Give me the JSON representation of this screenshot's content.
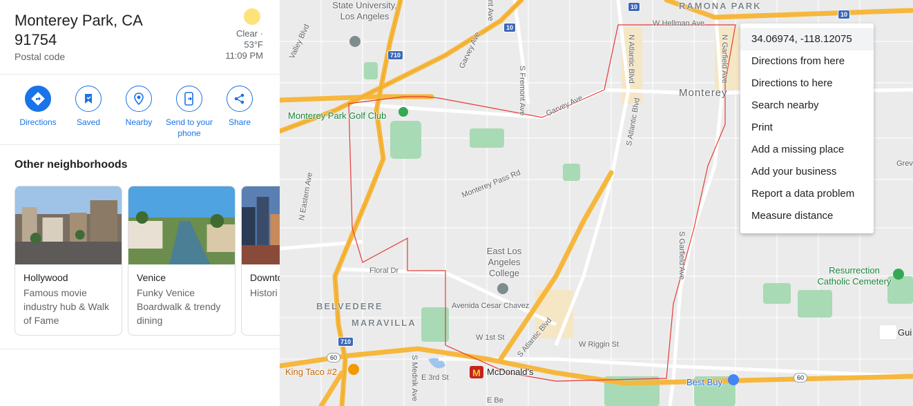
{
  "place": {
    "title": "Monterey Park, CA 91754",
    "subtitle": "Postal code",
    "weather": {
      "condition": "Clear ·",
      "temperature": "53°F",
      "time": "11:09 PM"
    }
  },
  "actions": [
    {
      "label": "Directions",
      "icon": "directions-icon"
    },
    {
      "label": "Saved",
      "icon": "bookmark-icon"
    },
    {
      "label": "Nearby",
      "icon": "nearby-icon"
    },
    {
      "label": "Send to your phone",
      "icon": "send-to-phone-icon"
    },
    {
      "label": "Share",
      "icon": "share-icon"
    }
  ],
  "neighborhoods": {
    "heading": "Other neighborhoods",
    "cards": [
      {
        "title": "Hollywood",
        "description": "Famous movie industry hub & Walk of Fame"
      },
      {
        "title": "Venice",
        "description": "Funky Venice Boardwalk & trendy dining"
      },
      {
        "title": "Downto",
        "description": "Histori cool ea"
      }
    ]
  },
  "map": {
    "labels": {
      "state_university": "State University, Los Angeles",
      "ramona_park": "RAMONA PARK",
      "monterey": "Monterey",
      "golf_club": "Monterey Park Golf Club",
      "belvedere": "BELVEDERE",
      "maravilla": "MARAVILLA",
      "elac": "East Los Angeles College",
      "resurrection": "Resurrection Catholic Cemetery",
      "king_taco": "King Taco #2",
      "mcdonalds": "McDonald's",
      "best_buy": "Best Buy",
      "gui": "Gui"
    },
    "streets": {
      "w_hellman": "W Hellman Ave",
      "garvey": "Garvey Ave",
      "garvey2": "Garvey Ave",
      "s_fremont": "S Fremont Ave",
      "monterey_pass": "Monterey Pass Rd",
      "s_atlantic": "S Atlantic Blvd",
      "s_atlantic2": "S Atlantic Blvd",
      "n_atlantic": "N Atlantic Blvd",
      "n_garfield": "N Garfield Ave",
      "s_garfield": "S Garfield Ave",
      "n_eastern": "N Eastern Ave",
      "floral": "Floral Dr",
      "cesar_chavez": "Avenida Cesar Chavez",
      "w_1st": "W 1st St",
      "w_riggin": "W Riggin St",
      "e_3rd": "E 3rd St",
      "s_mednik": "S Mednik Ave",
      "valley": "Valley Blvd",
      "nt_ave": "nt Ave",
      "grev": "Grev",
      "e_be": "E Be"
    },
    "shields": {
      "i10a": "10",
      "i10b": "10",
      "i10c": "10",
      "i710a": "710",
      "i710b": "710",
      "r60a": "60",
      "r60b": "60"
    }
  },
  "context_menu": {
    "coordinates": "34.06974, -118.12075",
    "items": [
      "Directions from here",
      "Directions to here",
      "Search nearby",
      "Print",
      "Add a missing place",
      "Add your business",
      "Report a data problem",
      "Measure distance"
    ]
  },
  "colors": {
    "accent": "#1a73e8",
    "highway": "#f6b73c",
    "boundary": "#e53935",
    "park": "#a8dab5"
  }
}
